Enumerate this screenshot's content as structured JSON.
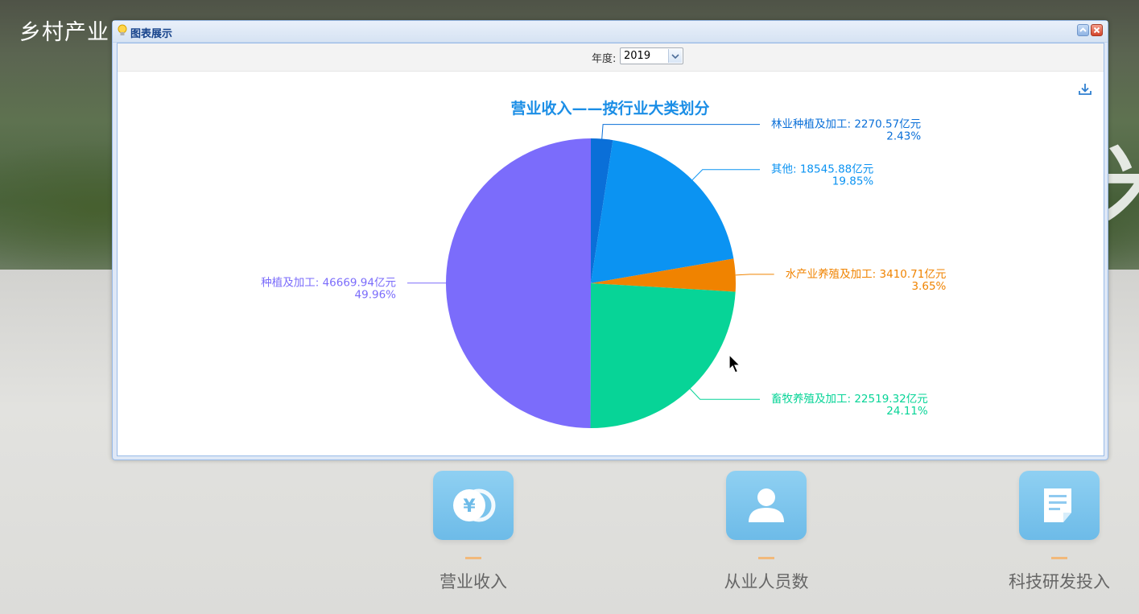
{
  "background": {
    "site_title": "乡村产业",
    "deco_glyph": "米",
    "tiles": [
      {
        "label": "营业收入",
        "icon": "yen-coins-icon"
      },
      {
        "label": "从业人员数",
        "icon": "person-icon"
      },
      {
        "label": "科技研发投入",
        "icon": "document-icon"
      }
    ]
  },
  "dialog": {
    "title": "图表展示",
    "title_icon": "lightbulb-icon",
    "toolbar": {
      "year_label": "年度:",
      "year_value": "2019"
    },
    "buttons": {
      "minimize": "minimize-icon",
      "close": "close-icon",
      "download": "download-icon"
    }
  },
  "colors": {
    "title": "#1b8ee6",
    "forestry": "#0a6fd8",
    "other": "#0b93f2",
    "aquaculture": "#f08300",
    "livestock": "#07d497",
    "planting": "#7b6cfb"
  },
  "chart_data": {
    "type": "pie",
    "title": "营业收入——按行业大类划分",
    "unit": "亿元",
    "slices": [
      {
        "name": "林业种植及加工",
        "value": 2270.57,
        "value_label": "2270.57亿元",
        "percent_label": "2.43%",
        "color": "#0a6fd8"
      },
      {
        "name": "其他",
        "value": 18545.88,
        "value_label": "18545.88亿元",
        "percent_label": "19.85%",
        "color": "#0b93f2"
      },
      {
        "name": "水产业养殖及加工",
        "value": 3410.71,
        "value_label": "3410.71亿元",
        "percent_label": "3.65%",
        "color": "#f08300"
      },
      {
        "name": "畜牧养殖及加工",
        "value": 22519.32,
        "value_label": "22519.32亿元",
        "percent_label": "24.11%",
        "color": "#07d497"
      },
      {
        "name": "种植及加工",
        "value": 46669.94,
        "value_label": "46669.94亿元",
        "percent_label": "49.96%",
        "color": "#7b6cfb"
      }
    ]
  }
}
